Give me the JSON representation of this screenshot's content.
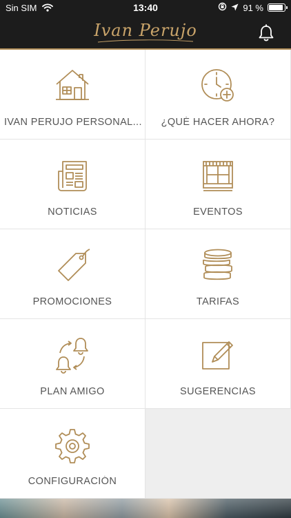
{
  "status_bar": {
    "carrier": "Sin SIM",
    "time": "13:40",
    "battery": "91 %",
    "battery_level": 0.91
  },
  "header": {
    "brand": "Ivan Perujo"
  },
  "menu": [
    {
      "label": "IVAN PERUJO PERSONAL...",
      "icon": "house-icon"
    },
    {
      "label": "¿QUÉ HACER AHORA?",
      "icon": "clock-add-icon"
    },
    {
      "label": "NOTICIAS",
      "icon": "newspaper-icon"
    },
    {
      "label": "EVENTOS",
      "icon": "calendar-grid-icon"
    },
    {
      "label": "PROMOCIONES",
      "icon": "price-tag-icon"
    },
    {
      "label": "TARIFAS",
      "icon": "coins-stack-icon"
    },
    {
      "label": "PLAN AMIGO",
      "icon": "bells-exchange-icon"
    },
    {
      "label": "SUGERENCIAS",
      "icon": "edit-note-icon"
    },
    {
      "label": "CONFIGURACIÓN",
      "icon": "gear-icon"
    }
  ],
  "colors": {
    "accent": "#b08d57",
    "header_bg": "#1c1c1c",
    "label": "#555555",
    "background": "#eeeeee"
  }
}
